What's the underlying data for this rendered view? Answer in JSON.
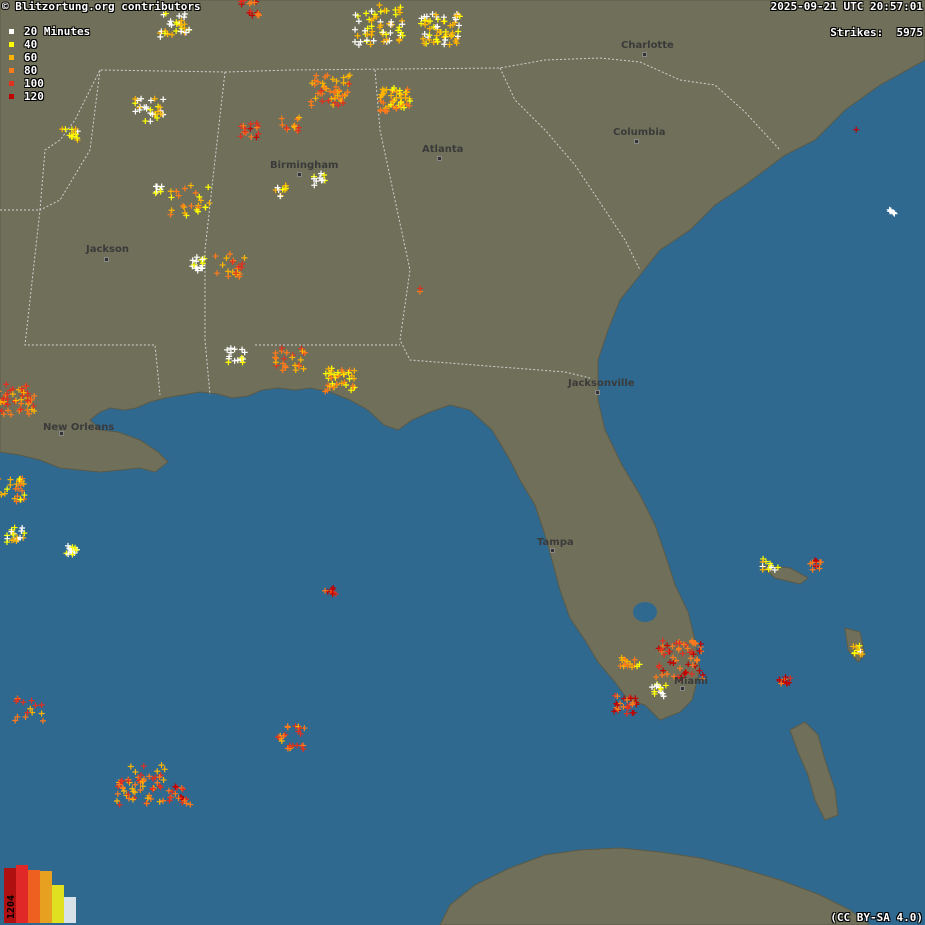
{
  "header": {
    "attribution": "© Blitzortung.org contributors",
    "timestamp": "2025-09-21 UTC 20:57:01",
    "strikes_label": "Strikes:",
    "strikes_count": "5975"
  },
  "legend": {
    "items": [
      {
        "label": "20 Minutes",
        "color": "#ffffff"
      },
      {
        "label": "40",
        "color": "#ffff00"
      },
      {
        "label": "60",
        "color": "#ffb400"
      },
      {
        "label": "80",
        "color": "#ff7a1a"
      },
      {
        "label": "100",
        "color": "#e0301e"
      },
      {
        "label": "120",
        "color": "#c00000"
      }
    ]
  },
  "histogram": {
    "peak_value": "1204",
    "bars": [
      {
        "color": "#b01010",
        "fraction": 0.95
      },
      {
        "color": "#e02828",
        "fraction": 1.0
      },
      {
        "color": "#ee6020",
        "fraction": 0.92
      },
      {
        "color": "#e8a020",
        "fraction": 0.9
      },
      {
        "color": "#e0e020",
        "fraction": 0.65
      },
      {
        "color": "#d8e0e8",
        "fraction": 0.45
      }
    ]
  },
  "cities": [
    {
      "name": "Charlotte"
    },
    {
      "name": "Columbia"
    },
    {
      "name": "Atlanta"
    },
    {
      "name": "Birmingham"
    },
    {
      "name": "Jackson"
    },
    {
      "name": "New Orleans"
    },
    {
      "name": "Jacksonville"
    },
    {
      "name": "Tampa"
    },
    {
      "name": "Miami"
    }
  ],
  "license": "(CC BY-SA 4.0)",
  "colors": {
    "water": "#30698f",
    "land": "#70705a",
    "border": "#cfcfcf"
  }
}
